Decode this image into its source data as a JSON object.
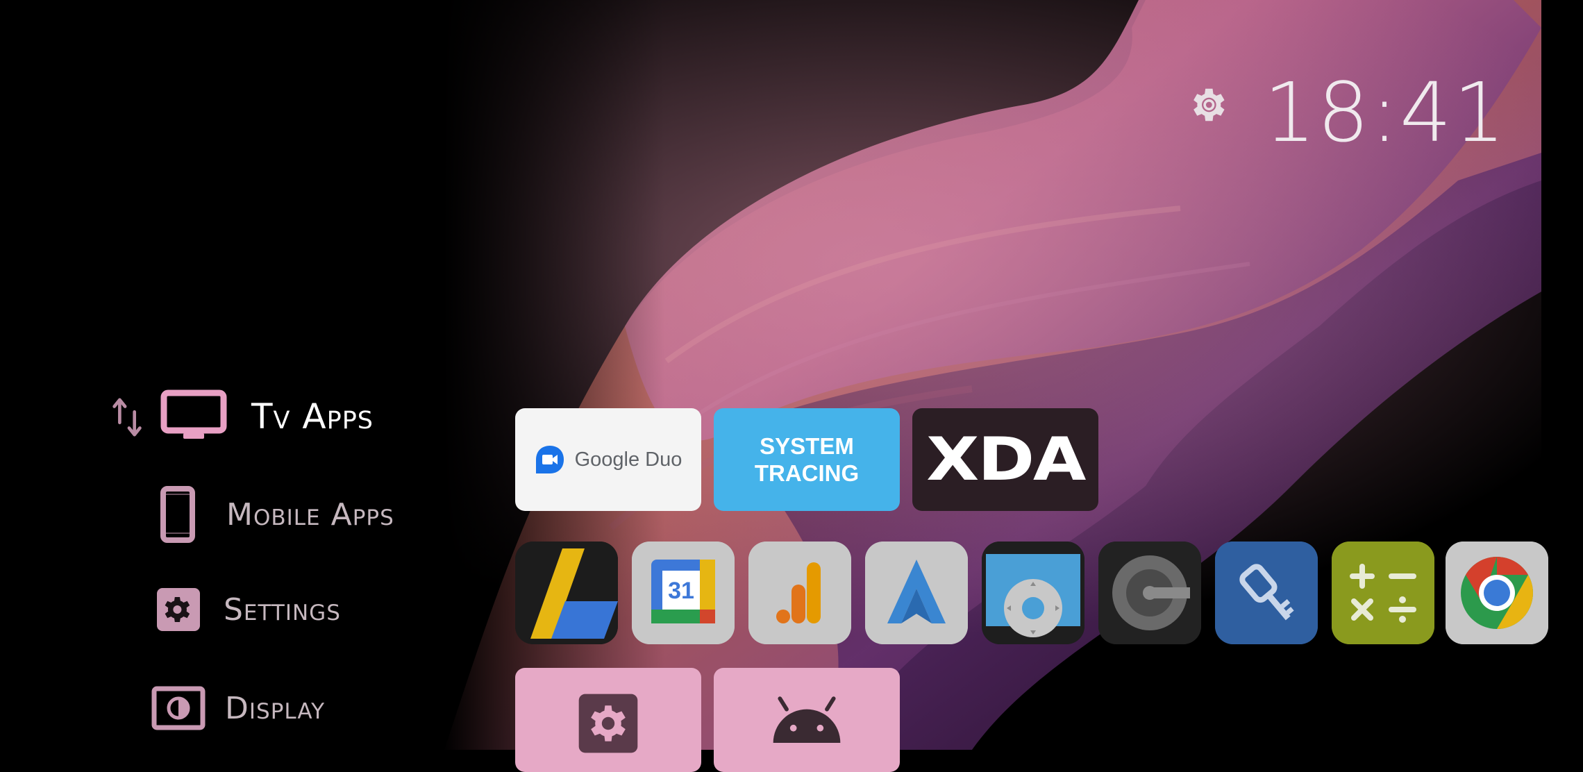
{
  "status": {
    "time": "18:41",
    "settings_icon": "gear-icon"
  },
  "sidebar": {
    "reorder_icon": "up-down-arrows-icon",
    "items": [
      {
        "label": "Tv Apps",
        "icon": "tv-icon",
        "active": true
      },
      {
        "label": "Mobile Apps",
        "icon": "smartphone-icon",
        "active": false
      },
      {
        "label": "Settings",
        "icon": "gear-icon",
        "active": false
      },
      {
        "label": "Display",
        "icon": "display-brightness-icon",
        "active": false
      }
    ]
  },
  "banners": [
    {
      "label": "Google Duo",
      "background": "#f4f4f4"
    },
    {
      "label_line1": "SYSTEM",
      "label_line2": "TRACING",
      "background": "#45b3ea"
    },
    {
      "label": "XDA",
      "background": "#2b1e24"
    }
  ],
  "apps": [
    {
      "icon": "google-adsense-icon"
    },
    {
      "icon": "google-calendar-icon",
      "text": "31"
    },
    {
      "icon": "google-analytics-icon"
    },
    {
      "icon": "android-auto-icon"
    },
    {
      "icon": "remote-control-icon"
    },
    {
      "icon": "google-authenticator-icon"
    },
    {
      "icon": "key-icon"
    },
    {
      "icon": "calculator-icon"
    },
    {
      "icon": "chrome-icon"
    }
  ],
  "bottom_row": [
    {
      "icon": "settings-gear-icon",
      "background": "#e6a9c6"
    },
    {
      "icon": "android-robot-icon",
      "background": "#e6a9c6"
    }
  ],
  "colors": {
    "accent_pink": "#e8a0c4",
    "label_grey": "#c6b8bf",
    "duo_blue": "#1a73e8",
    "tracing_blue": "#45b3ea"
  }
}
